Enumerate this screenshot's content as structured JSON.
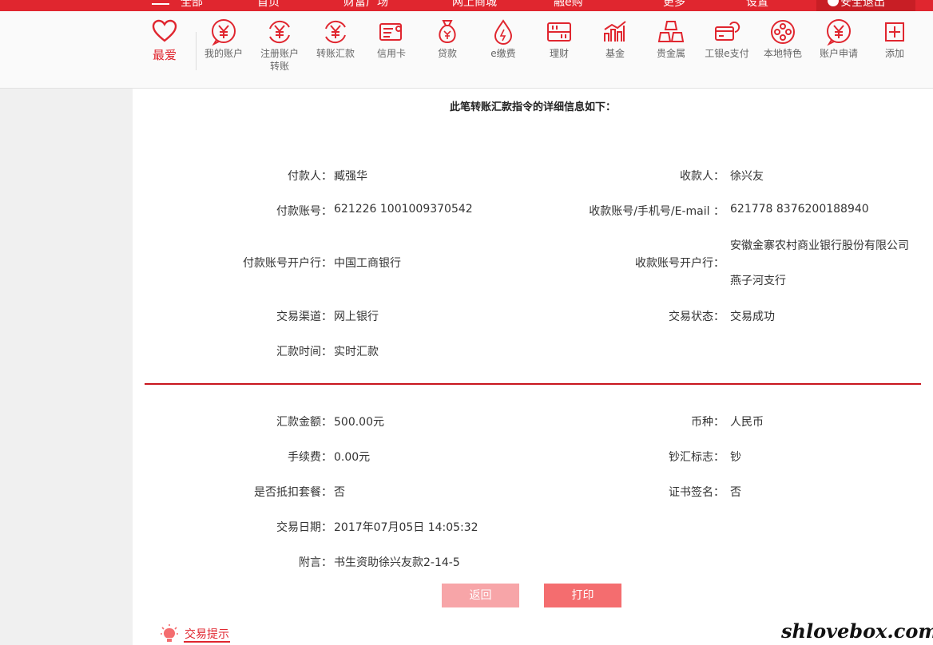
{
  "colors": {
    "brand_red": "#e0262f",
    "divider_red": "#c8161e",
    "btn_back": "#f7a5a8",
    "btn_print": "#f46d6f"
  },
  "topbar": {
    "items": [
      "全部",
      "首页",
      "财富广场",
      "网上商城",
      "融e购",
      "更多",
      "设置"
    ],
    "login": "安全退出"
  },
  "nav": {
    "favorite": {
      "label": "最爱",
      "icon": "heart-icon"
    },
    "items": [
      {
        "label": "我的账户",
        "icon": "yuan-icon"
      },
      {
        "label": "注册账户\n转账",
        "icon": "yuan-transfer-icon"
      },
      {
        "label": "转账汇款",
        "icon": "yuan-transfer-icon"
      },
      {
        "label": "信用卡",
        "icon": "credit-card-icon"
      },
      {
        "label": "贷款",
        "icon": "money-bag-icon"
      },
      {
        "label": "e缴费",
        "icon": "drop-icon"
      },
      {
        "label": "理财",
        "icon": "abacus-icon"
      },
      {
        "label": "基金",
        "icon": "bar-chart-icon"
      },
      {
        "label": "贵金属",
        "icon": "gold-bars-icon"
      },
      {
        "label": "工银e支付",
        "icon": "pay-card-icon"
      },
      {
        "label": "本地特色",
        "icon": "film-reel-icon"
      },
      {
        "label": "账户申请",
        "icon": "yuan-icon"
      },
      {
        "label": "添加",
        "icon": "plus-icon"
      }
    ]
  },
  "detail": {
    "title": "此笔转账汇款指令的详细信息如下：",
    "payer_label": "付款人：",
    "payer": "臧强华",
    "payee_label": "收款人：",
    "payee": "徐兴友",
    "payer_account_label": "付款账号：",
    "payer_account": "621226 1001009370542",
    "payee_account_label": "收款账号/手机号/E-mail ：",
    "payee_account": "621778 8376200188940",
    "payer_bank_label": "付款账号开户行：",
    "payer_bank": "中国工商银行",
    "payee_bank_label": "收款账号开户行：",
    "payee_bank_line1": "安徽金寨农村商业银行股份有限公司",
    "payee_bank_line2": "燕子河支行",
    "channel_label": "交易渠道：",
    "channel": "网上银行",
    "status_label": "交易状态：",
    "status": "交易成功",
    "remit_time_label": "汇款时间：",
    "remit_time": "实时汇款",
    "amount_label": "汇款金额：",
    "amount": "500.00元",
    "currency_label": "币种：",
    "currency": "人民币",
    "fee_label": "手续费：",
    "fee": "0.00元",
    "cash_flag_label": "钞汇标志：",
    "cash_flag": "钞",
    "package_label": "是否抵扣套餐：",
    "package": "否",
    "cert_label": "证书签名：",
    "cert": "否",
    "date_label": "交易日期：",
    "date": "2017年07月05日 14:05:32",
    "memo_label": "附言：",
    "memo": "书生资助徐兴友款2-14-5"
  },
  "buttons": {
    "back": "返回",
    "print": "打印"
  },
  "tips": {
    "label": "交易提示"
  },
  "watermark": "shlovebox.com"
}
